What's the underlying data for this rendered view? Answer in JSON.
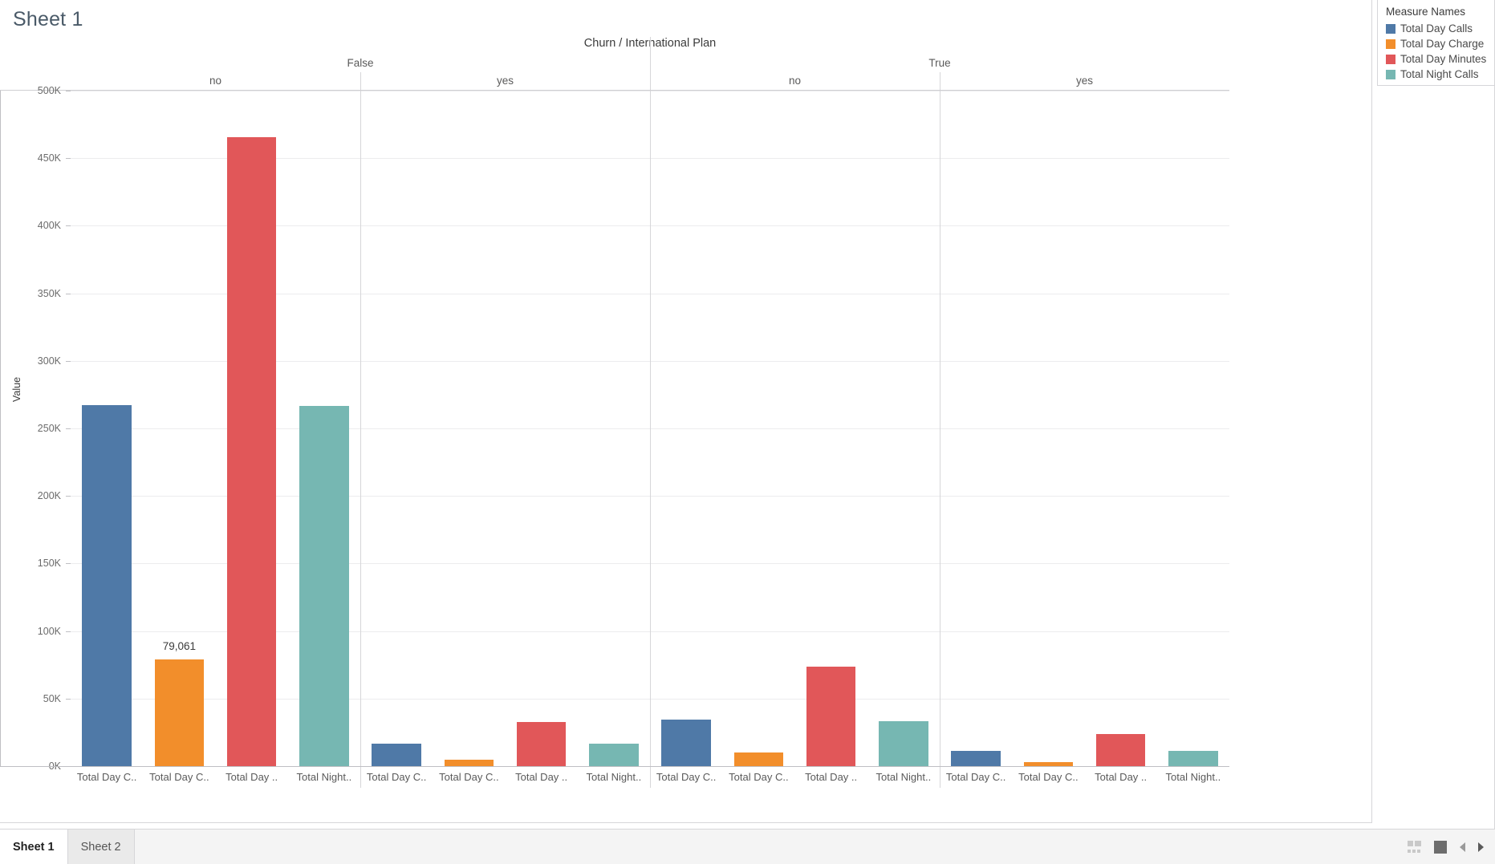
{
  "window": {
    "sheet_title": "Sheet 1"
  },
  "legend": {
    "title": "Measure Names",
    "items": [
      {
        "label": "Total Day Calls",
        "color": "#4f79a7"
      },
      {
        "label": "Total Day Charge",
        "color": "#f28e2b"
      },
      {
        "label": "Total Day Minutes",
        "color": "#e15759"
      },
      {
        "label": "Total Night Calls",
        "color": "#76b7b2"
      }
    ]
  },
  "bottom_bar": {
    "tabs": [
      {
        "label": "Sheet 1",
        "active": true
      },
      {
        "label": "Sheet 2",
        "active": false
      }
    ],
    "icons": [
      {
        "name": "show-me-grid-icon"
      },
      {
        "name": "dashboard-square-icon"
      },
      {
        "name": "nav-prev-arrow-icon"
      },
      {
        "name": "nav-next-arrow-icon"
      }
    ]
  },
  "chart_data": {
    "type": "bar",
    "title": "Churn / International Plan",
    "xlabel": "",
    "ylabel": "Value",
    "ylim": [
      0,
      500000
    ],
    "ytick_step": 50000,
    "ytick_labels": [
      "0K",
      "50K",
      "100K",
      "150K",
      "200K",
      "250K",
      "300K",
      "350K",
      "400K",
      "450K",
      "500K"
    ],
    "grid": true,
    "legend_position": "right",
    "column_header_levels": [
      {
        "field": "Churn",
        "values": [
          "False",
          "True"
        ]
      },
      {
        "field": "International Plan",
        "values": [
          "no",
          "yes",
          "no",
          "yes"
        ]
      }
    ],
    "categories": [
      "Total Day C..",
      "Total Day C..",
      "Total Day ..",
      "Total Night..",
      "Total Day C..",
      "Total Day C..",
      "Total Day ..",
      "Total Night..",
      "Total Day C..",
      "Total Day C..",
      "Total Day ..",
      "Total Night..",
      "Total Day C..",
      "Total Day C..",
      "Total Day ..",
      "Total Night.."
    ],
    "panels": [
      {
        "churn": "False",
        "international_plan": "no",
        "bars": [
          {
            "measure": "Total Day Calls",
            "label_short": "Total Day C..",
            "value": 267500,
            "color": "#4f79a7",
            "data_label": null
          },
          {
            "measure": "Total Day Charge",
            "label_short": "Total Day C..",
            "value": 79061,
            "color": "#f28e2b",
            "data_label": "79,061"
          },
          {
            "measure": "Total Day Minutes",
            "label_short": "Total Day ..",
            "value": 465500,
            "color": "#e15759",
            "data_label": null
          },
          {
            "measure": "Total Night Calls",
            "label_short": "Total Night..",
            "value": 266500,
            "color": "#76b7b2",
            "data_label": null
          }
        ]
      },
      {
        "churn": "False",
        "international_plan": "yes",
        "bars": [
          {
            "measure": "Total Day Calls",
            "label_short": "Total Day C..",
            "value": 16500,
            "color": "#4f79a7",
            "data_label": null
          },
          {
            "measure": "Total Day Charge",
            "label_short": "Total Day C..",
            "value": 4500,
            "color": "#f28e2b",
            "data_label": null
          },
          {
            "measure": "Total Day Minutes",
            "label_short": "Total Day ..",
            "value": 32500,
            "color": "#e15759",
            "data_label": null
          },
          {
            "measure": "Total Night Calls",
            "label_short": "Total Night..",
            "value": 16500,
            "color": "#76b7b2",
            "data_label": null
          }
        ]
      },
      {
        "churn": "True",
        "international_plan": "no",
        "bars": [
          {
            "measure": "Total Day Calls",
            "label_short": "Total Day C..",
            "value": 34500,
            "color": "#4f79a7",
            "data_label": null
          },
          {
            "measure": "Total Day Charge",
            "label_short": "Total Day C..",
            "value": 10000,
            "color": "#f28e2b",
            "data_label": null
          },
          {
            "measure": "Total Day Minutes",
            "label_short": "Total Day ..",
            "value": 73500,
            "color": "#e15759",
            "data_label": null
          },
          {
            "measure": "Total Night Calls",
            "label_short": "Total Night..",
            "value": 33000,
            "color": "#76b7b2",
            "data_label": null
          }
        ]
      },
      {
        "churn": "True",
        "international_plan": "yes",
        "bars": [
          {
            "measure": "Total Day Calls",
            "label_short": "Total Day C..",
            "value": 11500,
            "color": "#4f79a7",
            "data_label": null
          },
          {
            "measure": "Total Day Charge",
            "label_short": "Total Day C..",
            "value": 3000,
            "color": "#f28e2b",
            "data_label": null
          },
          {
            "measure": "Total Day Minutes",
            "label_short": "Total Day ..",
            "value": 24000,
            "color": "#e15759",
            "data_label": null
          },
          {
            "measure": "Total Night Calls",
            "label_short": "Total Night..",
            "value": 11500,
            "color": "#76b7b2",
            "data_label": null
          }
        ]
      }
    ]
  }
}
